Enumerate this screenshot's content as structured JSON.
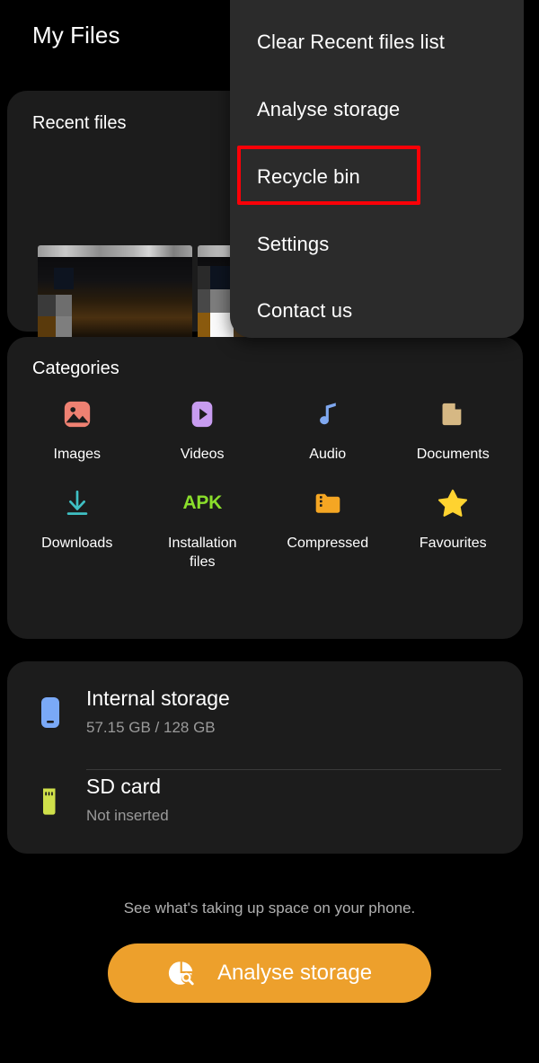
{
  "header": {
    "title": "My Files"
  },
  "recent": {
    "title": "Recent files",
    "thumbnails": [
      "recent-thumbnail-1",
      "recent-thumbnail-2",
      "recent-thumbnail-3"
    ]
  },
  "menu": {
    "items": [
      {
        "label": "Clear Recent files list",
        "icon": "clear-list-item"
      },
      {
        "label": "Analyse storage",
        "icon": "analyse-storage-item"
      },
      {
        "label": "Recycle bin",
        "icon": "recycle-bin-item"
      },
      {
        "label": "Settings",
        "icon": "settings-item"
      },
      {
        "label": "Contact us",
        "icon": "contact-us-item"
      }
    ],
    "highlighted_item": "Recycle bin",
    "highlight_color": "#fb0007",
    "panel_color": "#2b2b2b"
  },
  "categories": {
    "title": "Categories",
    "items": [
      {
        "label": "Images",
        "icon": "image-icon",
        "color": "#ef8172"
      },
      {
        "label": "Videos",
        "icon": "video-play-icon",
        "color": "#c89cf0"
      },
      {
        "label": "Audio",
        "icon": "music-note-icon",
        "color": "#7fa8f0"
      },
      {
        "label": "Documents",
        "icon": "document-icon",
        "color": "#d6b884"
      },
      {
        "label": "Downloads",
        "icon": "download-icon",
        "color": "#3fc0c4"
      },
      {
        "label": "Installation\nfiles",
        "icon": "apk-icon",
        "color": "#8ade2b",
        "glyph_text": "APK"
      },
      {
        "label": "Compressed",
        "icon": "zip-folder-icon",
        "color": "#f5a623"
      },
      {
        "label": "Favourites",
        "icon": "star-icon",
        "color": "#ffd330"
      }
    ]
  },
  "storage": {
    "rows": [
      {
        "name": "Internal storage",
        "sub": "57.15 GB / 128 GB",
        "icon": "phone-icon",
        "color": "#7aa9f7"
      },
      {
        "name": "SD card",
        "sub": "Not inserted",
        "icon": "sd-card-icon",
        "color": "#cfe04a"
      }
    ]
  },
  "footer": {
    "hint": "See what's taking up space on your phone.",
    "button_label": "Analyse storage",
    "button_icon": "pie-chart-search-icon",
    "button_color": "#eda02c"
  }
}
